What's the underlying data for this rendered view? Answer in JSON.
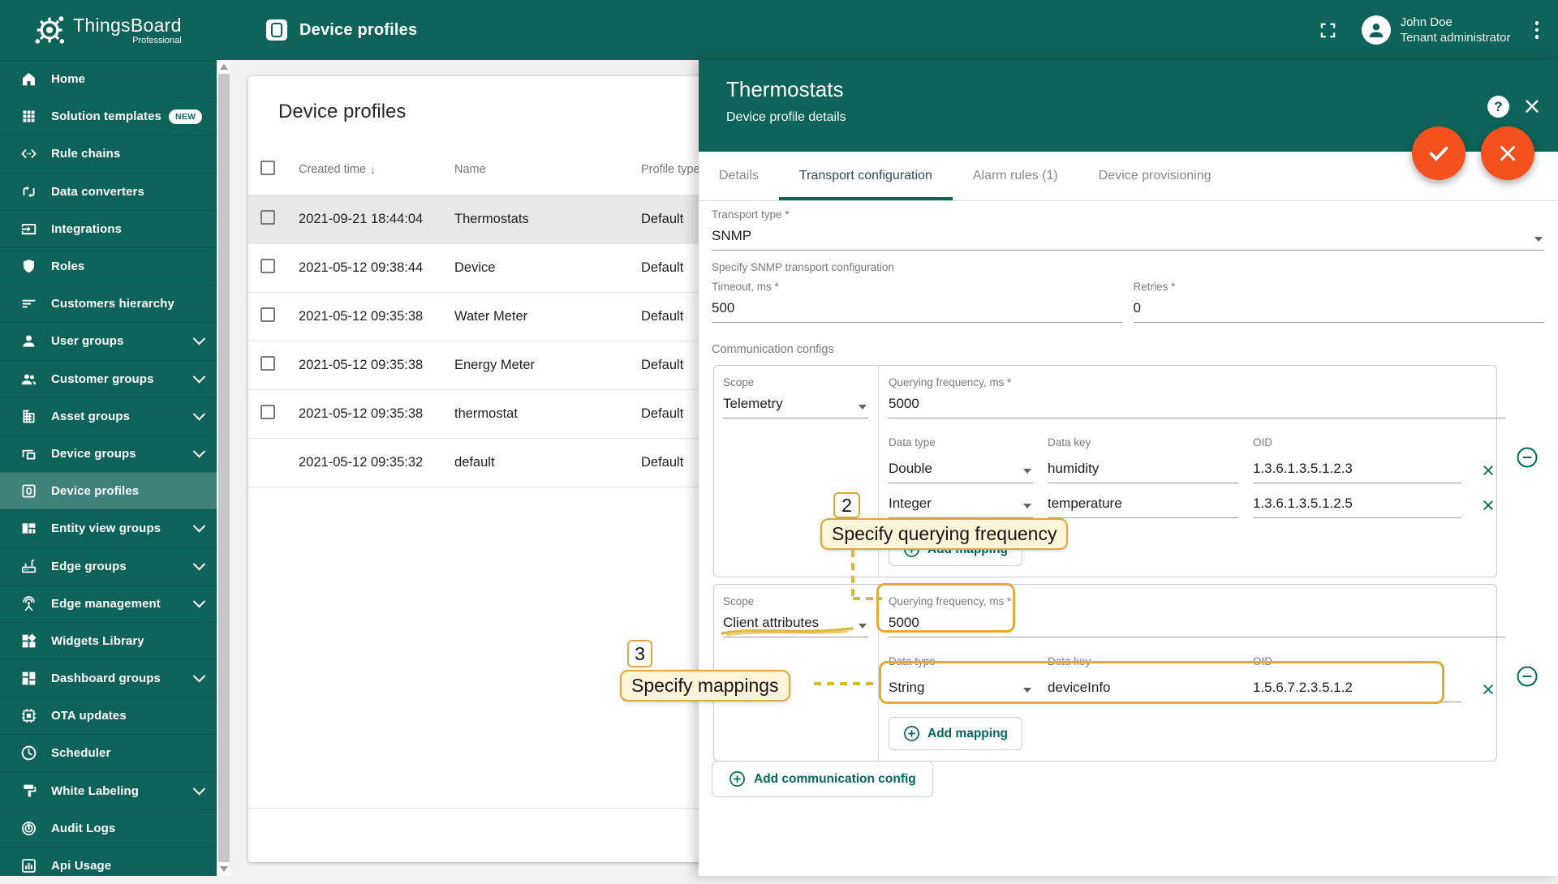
{
  "app": {
    "logo_title": "ThingsBoard",
    "logo_subtitle": "Professional"
  },
  "topbar": {
    "title": "Device profiles",
    "user": {
      "name": "John Doe",
      "role": "Tenant administrator"
    }
  },
  "sidebar": {
    "items": [
      {
        "label": "Home",
        "icon": "home",
        "cls": "sb-item"
      },
      {
        "label": "Solution templates",
        "icon": "apps",
        "badge": "NEW",
        "cls": "sb-item"
      },
      {
        "label": "Rule chains",
        "icon": "code",
        "cls": "sb-item"
      },
      {
        "label": "Data converters",
        "icon": "transform",
        "cls": "sb-item"
      },
      {
        "label": "Integrations",
        "icon": "input",
        "cls": "sb-item"
      },
      {
        "label": "Roles",
        "icon": "shield",
        "cls": "sb-item"
      },
      {
        "label": "Customers hierarchy",
        "icon": "sort",
        "cls": "sb-item"
      },
      {
        "label": "User groups",
        "icon": "person",
        "chevron": true,
        "cls": "sb-item"
      },
      {
        "label": "Customer groups",
        "icon": "people",
        "chevron": true,
        "cls": "sb-item"
      },
      {
        "label": "Asset groups",
        "icon": "domain",
        "chevron": true,
        "cls": "sb-item"
      },
      {
        "label": "Device groups",
        "icon": "devices",
        "chevron": true,
        "cls": "sb-item"
      },
      {
        "label": "Device profiles",
        "icon": "devprofile",
        "cls": "sb-item selected"
      },
      {
        "label": "Entity view groups",
        "icon": "quilt",
        "chevron": true,
        "cls": "sb-item"
      },
      {
        "label": "Edge groups",
        "icon": "router",
        "chevron": true,
        "cls": "sb-item"
      },
      {
        "label": "Edge management",
        "icon": "antenna",
        "chevron": true,
        "cls": "sb-item"
      },
      {
        "label": "Widgets Library",
        "icon": "widgets",
        "cls": "sb-item"
      },
      {
        "label": "Dashboard groups",
        "icon": "dashboard",
        "chevron": true,
        "cls": "sb-item"
      },
      {
        "label": "OTA updates",
        "icon": "chip",
        "cls": "sb-item"
      },
      {
        "label": "Scheduler",
        "icon": "clock",
        "cls": "sb-item"
      },
      {
        "label": "White Labeling",
        "icon": "roller",
        "chevron": true,
        "cls": "sb-item"
      },
      {
        "label": "Audit Logs",
        "icon": "track",
        "cls": "sb-item"
      },
      {
        "label": "Api Usage",
        "icon": "chart",
        "cls": "sb-item"
      }
    ]
  },
  "table": {
    "title": "Device profiles",
    "columns": {
      "created": "Created time",
      "name": "Name",
      "type": "Profile type"
    },
    "rows": [
      {
        "created": "2021-09-21 18:44:04",
        "name": "Thermostats",
        "type": "Default",
        "has_checkbox": true,
        "cls": "trow selected"
      },
      {
        "created": "2021-05-12 09:38:44",
        "name": "Device",
        "type": "Default",
        "has_checkbox": true,
        "cls": "trow"
      },
      {
        "created": "2021-05-12 09:35:38",
        "name": "Water Meter",
        "type": "Default",
        "has_checkbox": true,
        "cls": "trow"
      },
      {
        "created": "2021-05-12 09:35:38",
        "name": "Energy Meter",
        "type": "Default",
        "has_checkbox": true,
        "cls": "trow"
      },
      {
        "created": "2021-05-12 09:35:38",
        "name": "thermostat",
        "type": "Default",
        "has_checkbox": true,
        "cls": "trow"
      },
      {
        "created": "2021-05-12 09:35:32",
        "name": "default",
        "type": "Default",
        "has_checkbox": false,
        "cls": "trow"
      }
    ]
  },
  "panel": {
    "title": "Thermostats",
    "subtitle": "Device profile details",
    "tabs": [
      {
        "label": "Details",
        "cls": "tab"
      },
      {
        "label": "Transport configuration",
        "cls": "tab active"
      },
      {
        "label": "Alarm rules (1)",
        "cls": "tab"
      },
      {
        "label": "Device provisioning",
        "cls": "tab"
      }
    ],
    "form": {
      "transport_type_label": "Transport type *",
      "transport_type": "SNMP",
      "hint": "Specify SNMP transport configuration",
      "timeout_label": "Timeout, ms *",
      "timeout": "500",
      "retries_label": "Retries *",
      "retries": "0",
      "section": "Communication configs",
      "scope_label": "Scope",
      "freq_label": "Querying frequency, ms *",
      "dt_label": "Data type",
      "dk_label": "Data key",
      "oid_label": "OID",
      "add_mapping": "Add mapping",
      "add_config": "Add communication config",
      "configs": [
        {
          "scope": "Telemetry",
          "frequency": "5000",
          "cls": "cfg-row cfg1",
          "mappings": [
            {
              "type": "Double",
              "key": "humidity",
              "oid": "1.3.6.1.3.5.1.2.3"
            },
            {
              "type": "Integer",
              "key": "temperature",
              "oid": "1.3.6.1.3.5.1.2.5"
            }
          ]
        },
        {
          "scope": "Client attributes",
          "frequency": "5000",
          "cls": "cfg-row cfg2",
          "mappings": [
            {
              "type": "String",
              "key": "deviceInfo",
              "oid": "1.5.6.7.2.3.5.1.2"
            }
          ]
        }
      ]
    }
  },
  "annotations": {
    "step2": {
      "number": "2",
      "label": "Specify querying frequency"
    },
    "step3": {
      "number": "3",
      "label": "Specify mappings"
    }
  },
  "colors": {
    "primary_green": "#0e6358",
    "accent_teal": "#00695c",
    "fab_orange": "#f4511e",
    "annotation_gold": "#dca83f",
    "annotation_bg": "#fdf5da",
    "selected_row": "#e8e8e8"
  }
}
